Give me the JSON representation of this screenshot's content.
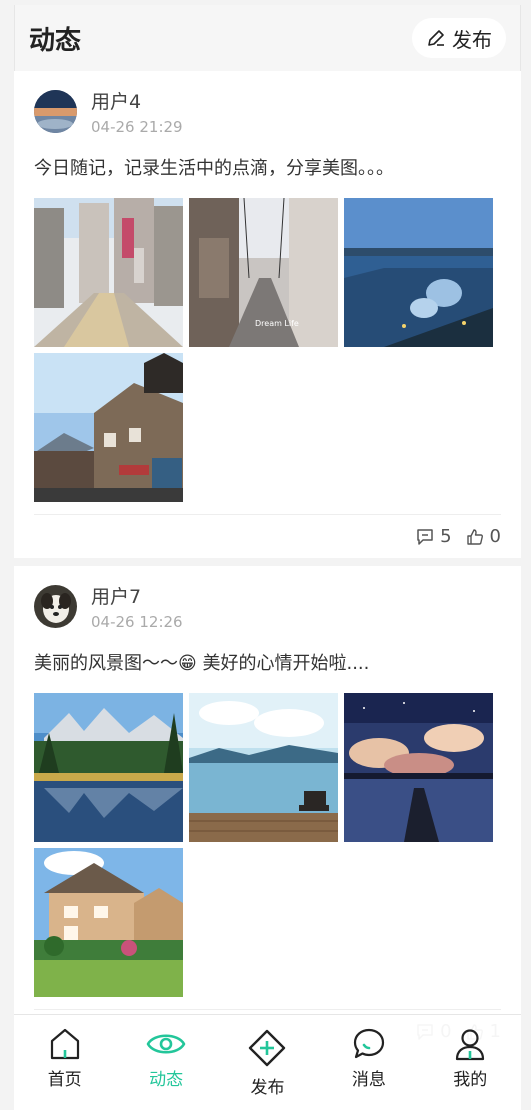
{
  "header": {
    "title": "动态",
    "publish_label": "发布"
  },
  "posts": [
    {
      "username": "用户4",
      "timestamp": "04-26 21:29",
      "text": "今日随记，记录生活中的点滴，分享美图。。。",
      "comments": "5",
      "likes": "0"
    },
    {
      "username": "用户7",
      "timestamp": "04-26 12:26",
      "text": "美丽的风景图～～😁 美好的心情开始啦....",
      "comments": "0",
      "likes": "1"
    }
  ],
  "tabs": [
    {
      "label": "首页",
      "icon": "home-icon"
    },
    {
      "label": "动态",
      "icon": "eye-icon"
    },
    {
      "label": "发布",
      "icon": "plus-diamond-icon"
    },
    {
      "label": "消息",
      "icon": "chat-bubble-icon"
    },
    {
      "label": "我的",
      "icon": "person-icon"
    }
  ],
  "colors": {
    "accent": "#23c69a",
    "background": "#f3f3f3"
  }
}
